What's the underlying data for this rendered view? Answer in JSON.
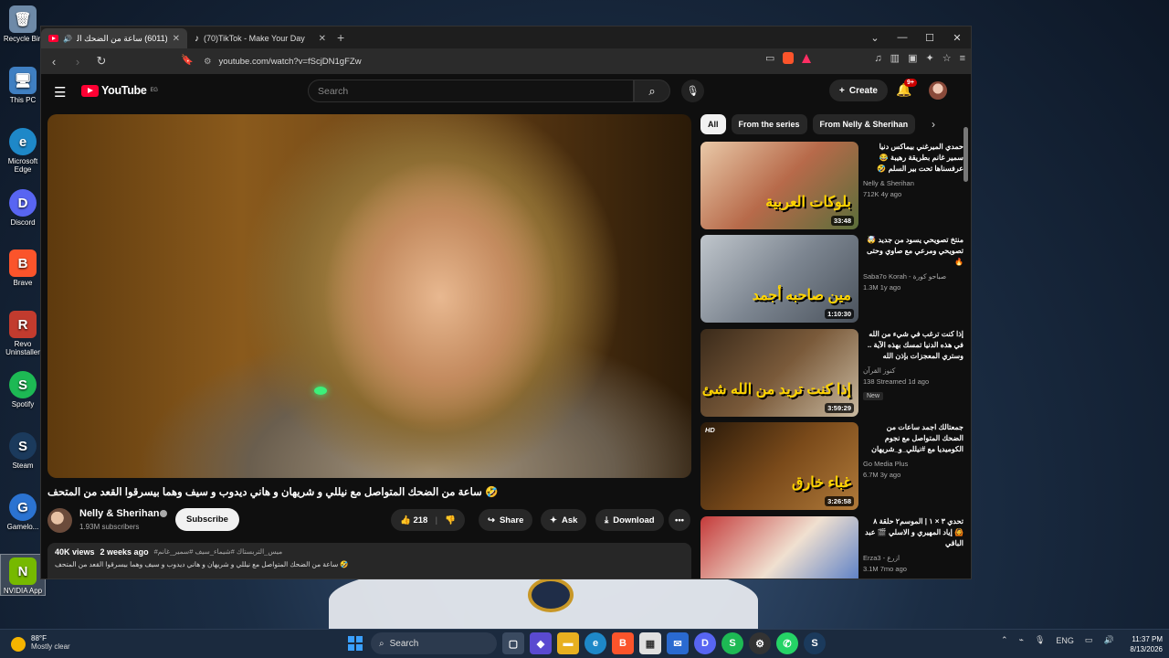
{
  "desktop": {
    "icons": [
      {
        "label": "Recycle Bin",
        "color": "#6e8aa8",
        "glyph": "🗑"
      },
      {
        "label": "This PC",
        "color": "#3f7fc2",
        "glyph": "🖥"
      },
      {
        "label": "Microsoft Edge",
        "color": "#1e88c8",
        "glyph": "e"
      },
      {
        "label": "Discord",
        "color": "#5865f2",
        "glyph": "D"
      },
      {
        "label": "Brave",
        "color": "#fb542b",
        "glyph": "B"
      },
      {
        "label": "Revo Uninstaller",
        "color": "#c23b2e",
        "glyph": "R"
      },
      {
        "label": "Spotify",
        "color": "#1db954",
        "glyph": "S"
      },
      {
        "label": "Steam",
        "color": "#1b3a5c",
        "glyph": "S"
      },
      {
        "label": "Gamelo...",
        "color": "#2b73d1",
        "glyph": "G"
      },
      {
        "label": "NVIDIA App",
        "color": "#76b900",
        "glyph": "N"
      }
    ]
  },
  "browser": {
    "tabs": [
      {
        "title": "(6011) ساعة من الضحك المتوا",
        "active": true
      },
      {
        "title": "(70)TikTok - Make Your Day",
        "active": false
      }
    ],
    "new_tab": "+",
    "url": "youtube.com/watch?v=fScjDN1gFZw"
  },
  "youtube": {
    "logo": "YouTube",
    "logo_region": "EG",
    "search_placeholder": "Search",
    "create_label": "Create",
    "notif_count": "9+",
    "video": {
      "title": "🤣 ساعة من الضحك المتواصل مع نيللي و شريهان و هاني ديدوب و سيف وهما بيسرقوا القعد من المتحف",
      "channel": "Nelly & Sherihan",
      "subscribers": "1.93M subscribers",
      "subscribe_label": "Subscribe",
      "likes": "218",
      "share_label": "Share",
      "ask_label": "Ask",
      "download_label": "Download",
      "views": "40K views",
      "age": "2 weeks ago",
      "tags": "#ميس_التربستاك #شيماء_سيف #سمير_غانم",
      "description": "🤣 ساعة من الضحك المتواصل مع نيللي و شريهان و هاني ديدوب و سيف وهما بيسرقوا القعد من المتحف"
    },
    "chips": [
      "All",
      "From the series",
      "From Nelly & Sherihan"
    ],
    "recommendations": [
      {
        "title": "حمدي الميرغني بيماكس دنيا سمير غانم بطريقة رهيبة 😂 عرفسناها تحت بير السلم 🤣",
        "channel": "Nelly & Sherihan",
        "stats": "712K  4y ago",
        "duration": "33:48",
        "overlay": "بلوكات العربية",
        "hd": "",
        "new": "",
        "bg": "linear-gradient(135deg,#e9c9a8,#b76a4a 50,#5a6e3a)"
      },
      {
        "title": "منتخ تصويحي يسود من جديد 🤯 تصويحي ومرعي مع صاوي وحتى 🔥",
        "channel": "Saba7o Korah - صباحو كورة",
        "stats": "1.3M  1y ago",
        "duration": "1:10:30",
        "overlay": "مين صاحبه أجمد",
        "hd": "",
        "new": "",
        "bg": "linear-gradient(135deg,#c0c6cc,#7c8590 50%,#4a525c)"
      },
      {
        "title": "إذا كنت ترغب في شيء من الله في هذه الدنيا تمسك بهذه الآية .. وستري المعجزات بإذن الله",
        "channel": "كنوز القرآن",
        "stats": "138  Streamed 1d ago",
        "duration": "3:59:29",
        "overlay": "إذا كنت تريد من الله شئ من امور الدنيا",
        "hd": "",
        "new": "New",
        "bg": "linear-gradient(135deg,#3a2a1a,#7a5a3a 50%,#c9b9a0)"
      },
      {
        "title": "جمعتالك اجمد ساعات من الضحك المتواصل مع نجوم الكوميديا مع #نيللي_و_شريهان",
        "channel": "Go Media Plus",
        "stats": "6.7M  3y ago",
        "duration": "3:26:58",
        "overlay": "غباء خارق",
        "hd": "HD",
        "new": "",
        "bg": "linear-gradient(135deg,#2a1a0a,#7a4a1a 50%,#b07a3a)"
      },
      {
        "title": "تحدي ٣ × ١ | الموسم٢ حلقة ٨ 🙆 إياد المهيري و الاسلي 🎬 عبد الباقي",
        "channel": "Erza3 - ازرع",
        "stats": "3.1M  7mo ago",
        "duration": "",
        "overlay": "",
        "hd": "",
        "new": "",
        "bg": "linear-gradient(135deg,#c43a3a,#f0e0d0 50%,#3a6ac4)"
      }
    ]
  },
  "taskbar": {
    "temp": "88°F",
    "weather": "Mostly clear",
    "search": "Search",
    "lang": "ENG",
    "time": "11:37 PM",
    "date": "8/13/2026"
  }
}
